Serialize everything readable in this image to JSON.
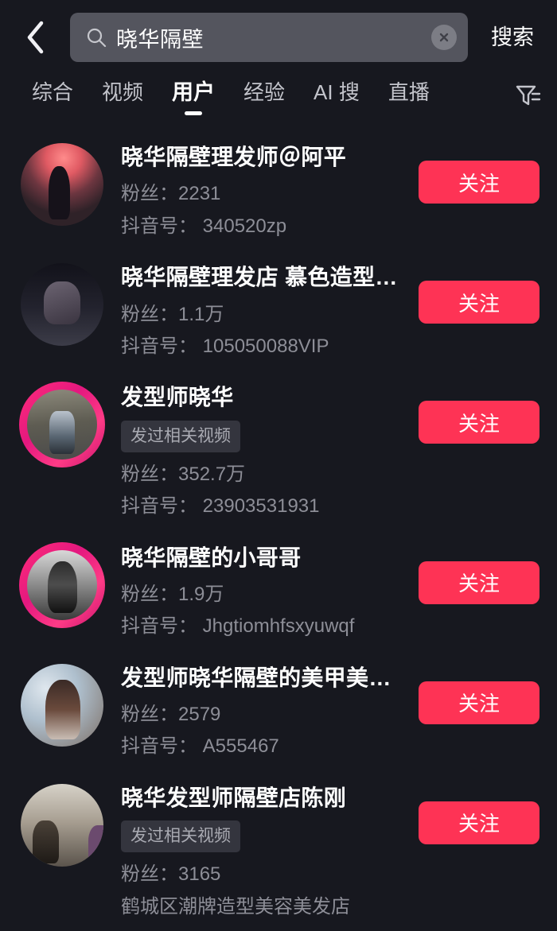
{
  "header": {
    "back_icon": "chevron-left-icon",
    "search": {
      "icon": "search-icon",
      "value": "晓华隔壁",
      "placeholder": "搜索",
      "clear_icon": "clear-circle-icon"
    },
    "action_label": "搜索"
  },
  "tabs": {
    "items": [
      {
        "label": "综合",
        "active": false
      },
      {
        "label": "视频",
        "active": false
      },
      {
        "label": "用户",
        "active": true
      },
      {
        "label": "经验",
        "active": false
      },
      {
        "label": "AI 搜",
        "active": false
      },
      {
        "label": "直播",
        "active": false
      }
    ],
    "filter_icon": "filter-icon"
  },
  "labels": {
    "follow": "关注"
  },
  "colors": {
    "background": "#17181f",
    "follow_button": "#fe3355",
    "search_field": "#54555e",
    "badge_background": "#34353e",
    "meta_text": "#8d8e97",
    "ring_accent": "#ff2d7a"
  },
  "results": [
    {
      "name": "晓华隔壁理发师＠阿平",
      "badge": "",
      "fans": "粉丝：2231",
      "sub": "抖音号： 340520zp",
      "ring": false,
      "avatar": "av-a",
      "follow": "关注"
    },
    {
      "name": "晓华隔壁理发店 慕色造型…",
      "badge": "",
      "fans": "粉丝：1.1万",
      "sub": "抖音号： 105050088VIP",
      "ring": false,
      "avatar": "av-b",
      "follow": "关注"
    },
    {
      "name": "发型师晓华",
      "badge": "发过相关视频",
      "fans": "粉丝：352.7万",
      "sub": "抖音号： 23903531931",
      "ring": true,
      "avatar": "av-c",
      "follow": "关注"
    },
    {
      "name": "晓华隔壁的小哥哥",
      "badge": "",
      "fans": "粉丝：1.9万",
      "sub": "抖音号： Jhgtiomhfsxyuwqf",
      "ring": true,
      "avatar": "av-d",
      "follow": "关注"
    },
    {
      "name": "发型师晓华隔壁的美甲美睫店",
      "badge": "",
      "fans": "粉丝：2579",
      "sub": "抖音号： A555467",
      "ring": false,
      "avatar": "av-e",
      "follow": "关注"
    },
    {
      "name": "晓华发型师隔壁店陈刚",
      "badge": "发过相关视频",
      "fans": "粉丝：3165",
      "sub": "鹤城区潮牌造型美容美发店",
      "ring": false,
      "avatar": "av-f",
      "follow": "关注"
    }
  ]
}
